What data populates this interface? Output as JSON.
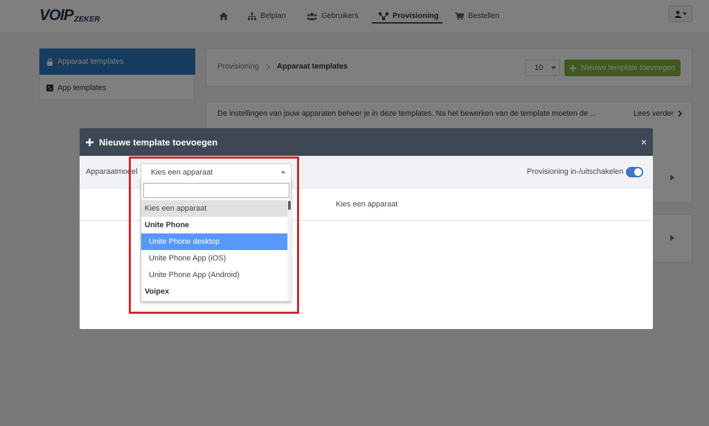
{
  "logo": {
    "main": "VOIP",
    "sub": "ZEKER"
  },
  "nav": {
    "home_icon": "home-icon",
    "items": [
      {
        "label": "Belplan",
        "icon": "sitemap-icon"
      },
      {
        "label": "Gebruikers",
        "icon": "users-icon"
      },
      {
        "label": "Provisioning",
        "icon": "network-icon",
        "active": true
      },
      {
        "label": "Bestellen",
        "icon": "cart-icon"
      }
    ],
    "user_icon": "user-icon"
  },
  "sidebar": {
    "items": [
      {
        "label": "Apparaat templates",
        "icon": "lock-icon",
        "active": true
      },
      {
        "label": "App templates",
        "icon": "phone-icon"
      }
    ]
  },
  "header": {
    "breadcrumb_parent": "Provisioning",
    "breadcrumb_current": "Apparaat templates",
    "per_page": "10",
    "new_button": "Nieuwe template toevoegen"
  },
  "info": {
    "text": "De instellingen van jouw apparaten beheer je in deze templates. Na het bewerken van de template moeten de ...",
    "read_more": "Lees verder"
  },
  "modal": {
    "title": "Nieuwe template toevoegen",
    "close": "×",
    "field_label": "Apparaatmodel",
    "select_value": "Kies een apparaat",
    "toggle_label": "Provisioning in-/uitschakelen",
    "toggle_on": true,
    "placeholder": "Kies een apparaat"
  },
  "dropdown": {
    "search_value": "",
    "items": [
      {
        "label": "Kies een apparaat",
        "type": "selected"
      },
      {
        "label": "Unite Phone",
        "type": "group"
      },
      {
        "label": "Unite Phone desktop",
        "type": "highlighted"
      },
      {
        "label": "Unite Phone App (iOS)",
        "type": "opt"
      },
      {
        "label": "Unite Phone App (Android)",
        "type": "opt"
      },
      {
        "label": "Voipex",
        "type": "group"
      }
    ]
  },
  "colors": {
    "accent_blue": "#2d79be",
    "button_green": "#7fb33d",
    "modal_header": "#3d4854",
    "highlight_red": "#d0262a",
    "option_highlight": "#5897fb"
  }
}
